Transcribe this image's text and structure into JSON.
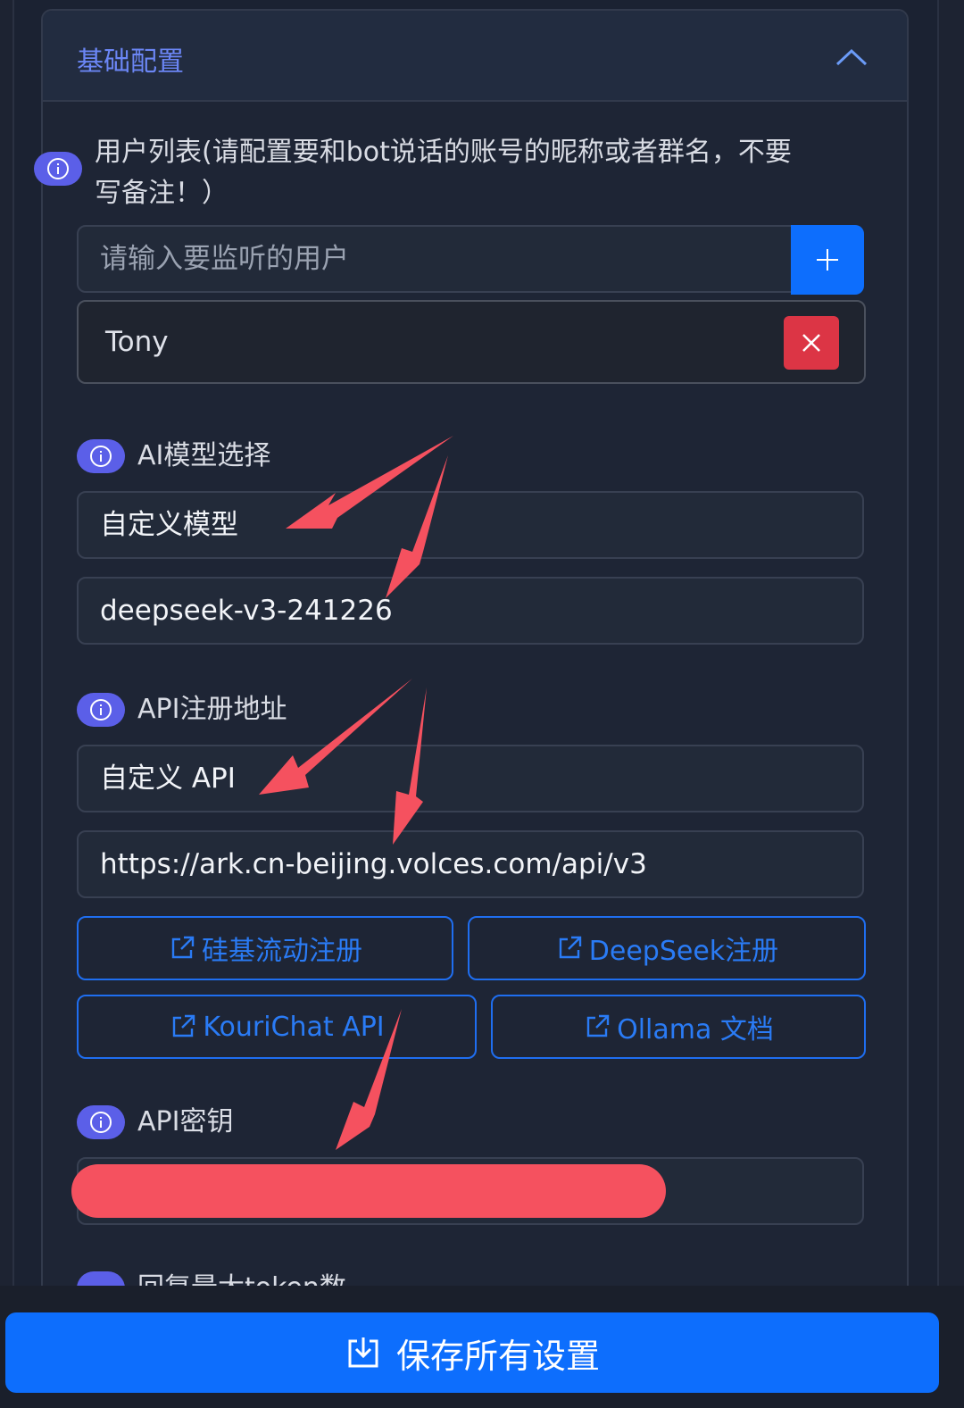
{
  "section": {
    "title": "基础配置",
    "collapse_icon": "chevron-up-icon"
  },
  "users": {
    "label": "用户列表(请配置要和bot说话的账号的昵称或者群名，不要写备注！）",
    "placeholder": "请输入要监听的用户",
    "add_icon": "plus-icon",
    "items": [
      {
        "name": "Tony",
        "remove_icon": "close-icon"
      }
    ]
  },
  "model": {
    "label": "AI模型选择",
    "provider": "自定义模型",
    "model_name": "deepseek-v3-241226"
  },
  "api": {
    "label": "API注册地址",
    "provider": "自定义 API",
    "url": "https://ark.cn-beijing.volces.com/api/v3",
    "links": [
      {
        "label": "硅基流动注册",
        "icon": "external-link-icon"
      },
      {
        "label": "DeepSeek注册",
        "icon": "external-link-icon"
      },
      {
        "label": "KouriChat API",
        "icon": "external-link-icon"
      },
      {
        "label": "Ollama 文档",
        "icon": "external-link-icon"
      }
    ]
  },
  "api_key": {
    "label": "API密钥"
  },
  "next_label_partial": "回复最大token数",
  "save": {
    "label": "保存所有设置",
    "icon": "download-icon"
  },
  "colors": {
    "primary": "#0d6efd",
    "danger": "#dc3545",
    "info": "#5b5fe8",
    "annotation": "#f5515f",
    "title": "#6b86f5"
  }
}
